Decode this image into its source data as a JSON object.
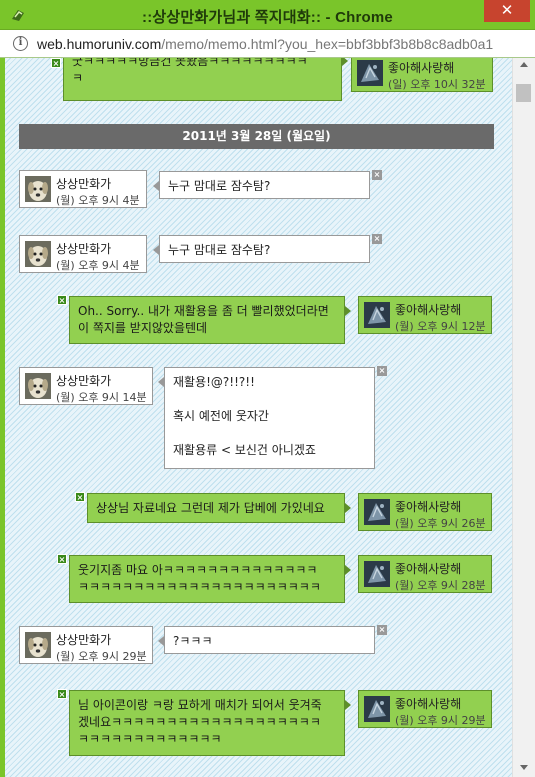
{
  "window": {
    "title": "::상상만화가님과 쪽지대화:: - Chrome",
    "close_glyph": "✕"
  },
  "urlbar": {
    "domain": "web.humoruniv.com",
    "path": "/memo/memo.html?you_hex=bbf3bbf3b8b8c8adb0a1"
  },
  "colors": {
    "title_bar": "#7ac52a",
    "green_bubble": "#92d050",
    "date_bar": "#6a6a6a",
    "close_button": "#c7442e"
  },
  "date_header": "2011년 3월 28일 (월요일)",
  "users": {
    "me": "좋아해사랑해",
    "other": "상상만화가"
  },
  "top_partial": {
    "message": [
      "굿ㅋㅋㅋㅋㅋ방금건 못봤음ㅋㅋㅋㅋㅋㅋㅋㅋㅋ",
      "ㅋ"
    ],
    "time": "(일) 오후 10시 32분"
  },
  "messages": [
    {
      "sender": "other",
      "time": "(월) 오후 9시 4분",
      "lines": [
        "누구 맘대로 잠수탐?"
      ]
    },
    {
      "sender": "other",
      "time": "(월) 오후 9시 4분",
      "lines": [
        "누구 맘대로 잠수탐?"
      ]
    },
    {
      "sender": "me",
      "time": "(월) 오후 9시 12분",
      "lines": [
        "Oh.. Sorry.. 내가 재활용을 좀 더 빨리했었더라면",
        "이 쪽지를 받지않았을텐데"
      ]
    },
    {
      "sender": "other",
      "time": "(월) 오후 9시 14분",
      "lines": [
        "재활용!@?!!?!!",
        "",
        "혹시 예전에 웃자간",
        "",
        "재활용류 < 보신건 아니겠죠"
      ]
    },
    {
      "sender": "me",
      "time": "(월) 오후 9시 26분",
      "lines": [
        "상상님 자료네요 그런데 제가 답베에 가있네요"
      ]
    },
    {
      "sender": "me",
      "time": "(월) 오후 9시 28분",
      "lines": [
        "웃기지좀 마요 아ㅋㅋㅋㅋㅋㅋㅋㅋㅋㅋㅋㅋㅋㅋ",
        "ㅋㅋㅋㅋㅋㅋㅋㅋㅋㅋㅋㅋㅋㅋㅋㅋㅋㅋㅋㅋㅋㅋ"
      ]
    },
    {
      "sender": "other",
      "time": "(월) 오후 9시 29분",
      "lines": [
        "?ㅋㅋㅋ"
      ]
    },
    {
      "sender": "me",
      "time": "(월) 오후 9시 29분",
      "lines": [
        "님 아이콘이랑 ㅋ랑 묘하게 매치가 되어서 웃겨죽",
        "겠네요ㅋㅋㅋㅋㅋㅋㅋㅋㅋㅋㅋㅋㅋㅋㅋㅋㅋㅋㅋ",
        "ㅋㅋㅋㅋㅋㅋㅋㅋㅋㅋㅋㅋㅋ"
      ]
    }
  ],
  "delete_glyph": "×"
}
